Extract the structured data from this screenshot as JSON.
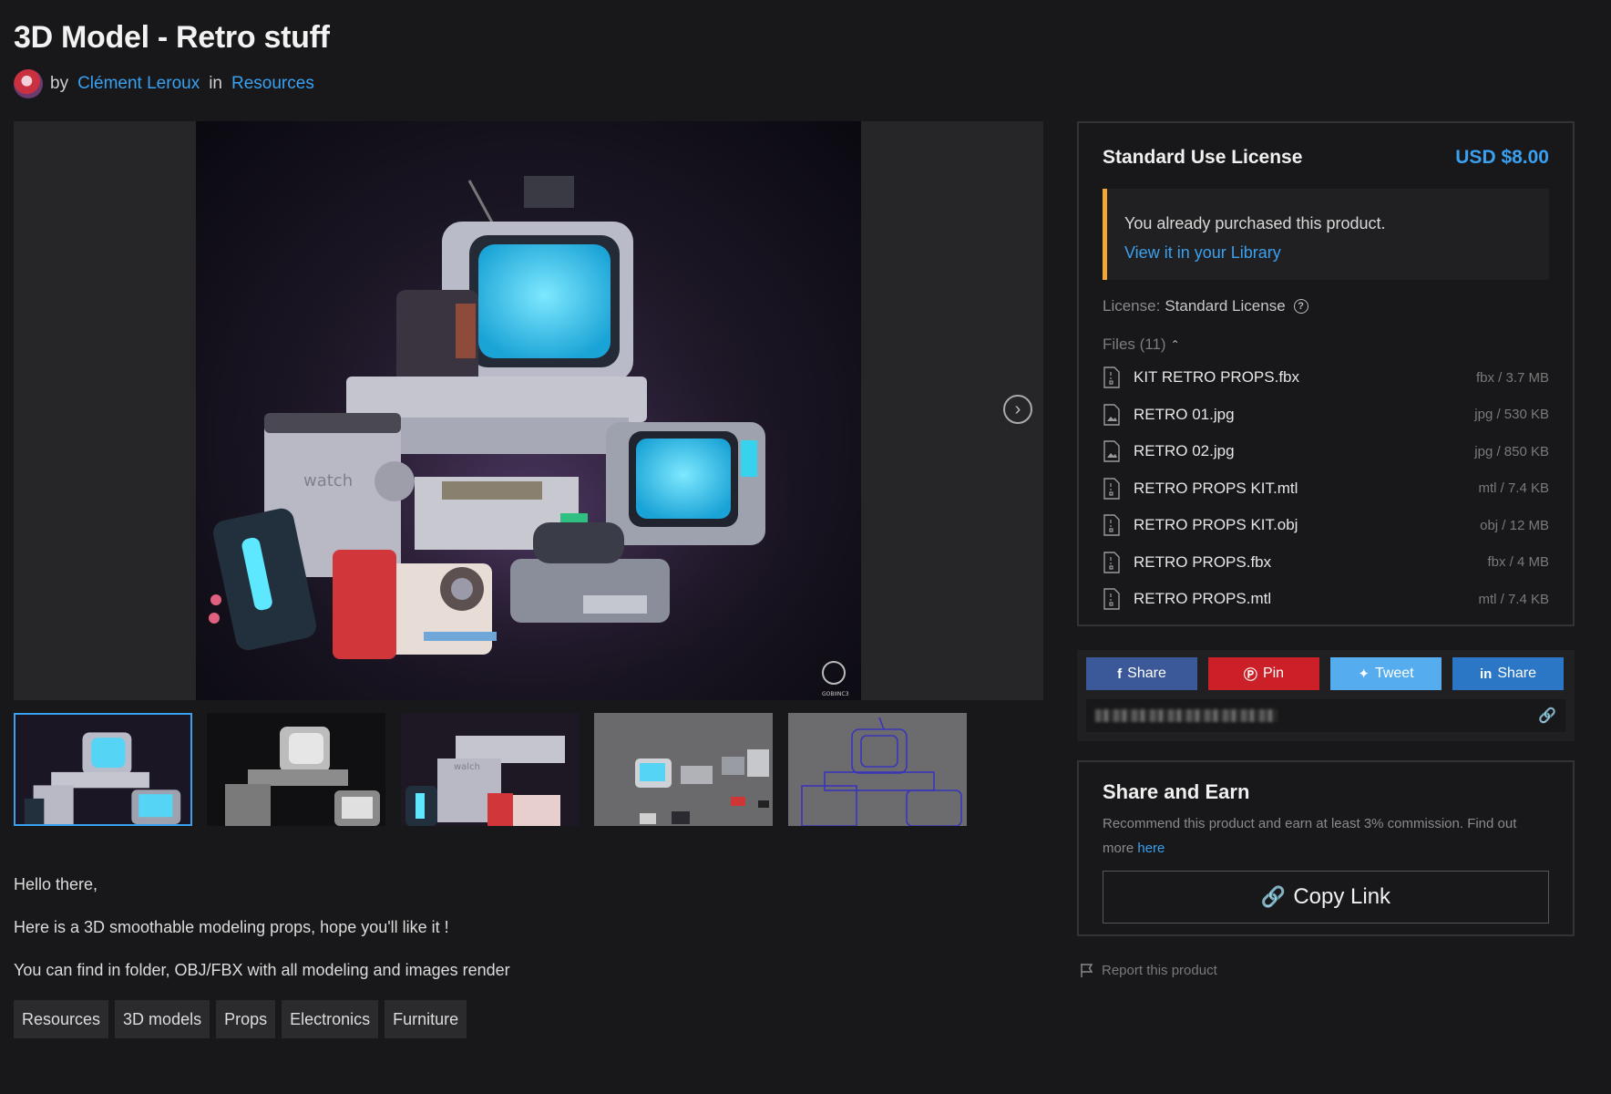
{
  "page": {
    "title": "3D Model - Retro stuff",
    "by_label": "by",
    "author": "Clément Leroux",
    "in_label": "in",
    "category": "Resources"
  },
  "gallery": {
    "next_icon": "chevron-right-icon",
    "watermark": "GOBIINC3"
  },
  "description": {
    "paragraphs": [
      "Hello there,",
      "Here is a 3D smoothable modeling props, hope you'll like it !",
      "You can find in folder, OBJ/FBX with all modeling and images render"
    ]
  },
  "tags": [
    "Resources",
    "3D models",
    "Props",
    "Electronics",
    "Furniture"
  ],
  "license": {
    "title": "Standard Use License",
    "price": "USD $8.00",
    "notice_text": "You already purchased this product.",
    "notice_link": "View it in your Library",
    "license_label": "License:",
    "license_value": "Standard License",
    "files_label": "Files (11)",
    "files": [
      {
        "name": "KIT RETRO PROPS.fbx",
        "meta": "fbx / 3.7 MB",
        "kind": "file"
      },
      {
        "name": "RETRO 01.jpg",
        "meta": "jpg / 530 KB",
        "kind": "image"
      },
      {
        "name": "RETRO 02.jpg",
        "meta": "jpg / 850 KB",
        "kind": "image"
      },
      {
        "name": "RETRO PROPS KIT.mtl",
        "meta": "mtl / 7.4 KB",
        "kind": "file"
      },
      {
        "name": "RETRO PROPS KIT.obj",
        "meta": "obj / 12 MB",
        "kind": "file"
      },
      {
        "name": "RETRO PROPS.fbx",
        "meta": "fbx / 4 MB",
        "kind": "file"
      },
      {
        "name": "RETRO PROPS.mtl",
        "meta": "mtl / 7.4 KB",
        "kind": "file"
      }
    ]
  },
  "share": {
    "facebook": "Share",
    "pinterest": "Pin",
    "twitter": "Tweet",
    "linkedin": "Share"
  },
  "earn": {
    "title": "Share and Earn",
    "text": "Recommend this product and earn at least 3% commission. Find out more",
    "link": "here",
    "copy_label": "Copy Link"
  },
  "report": "Report this product",
  "colors": {
    "background": "#18181a",
    "accent": "#3aa0f0",
    "notice_border": "#f0a830"
  }
}
